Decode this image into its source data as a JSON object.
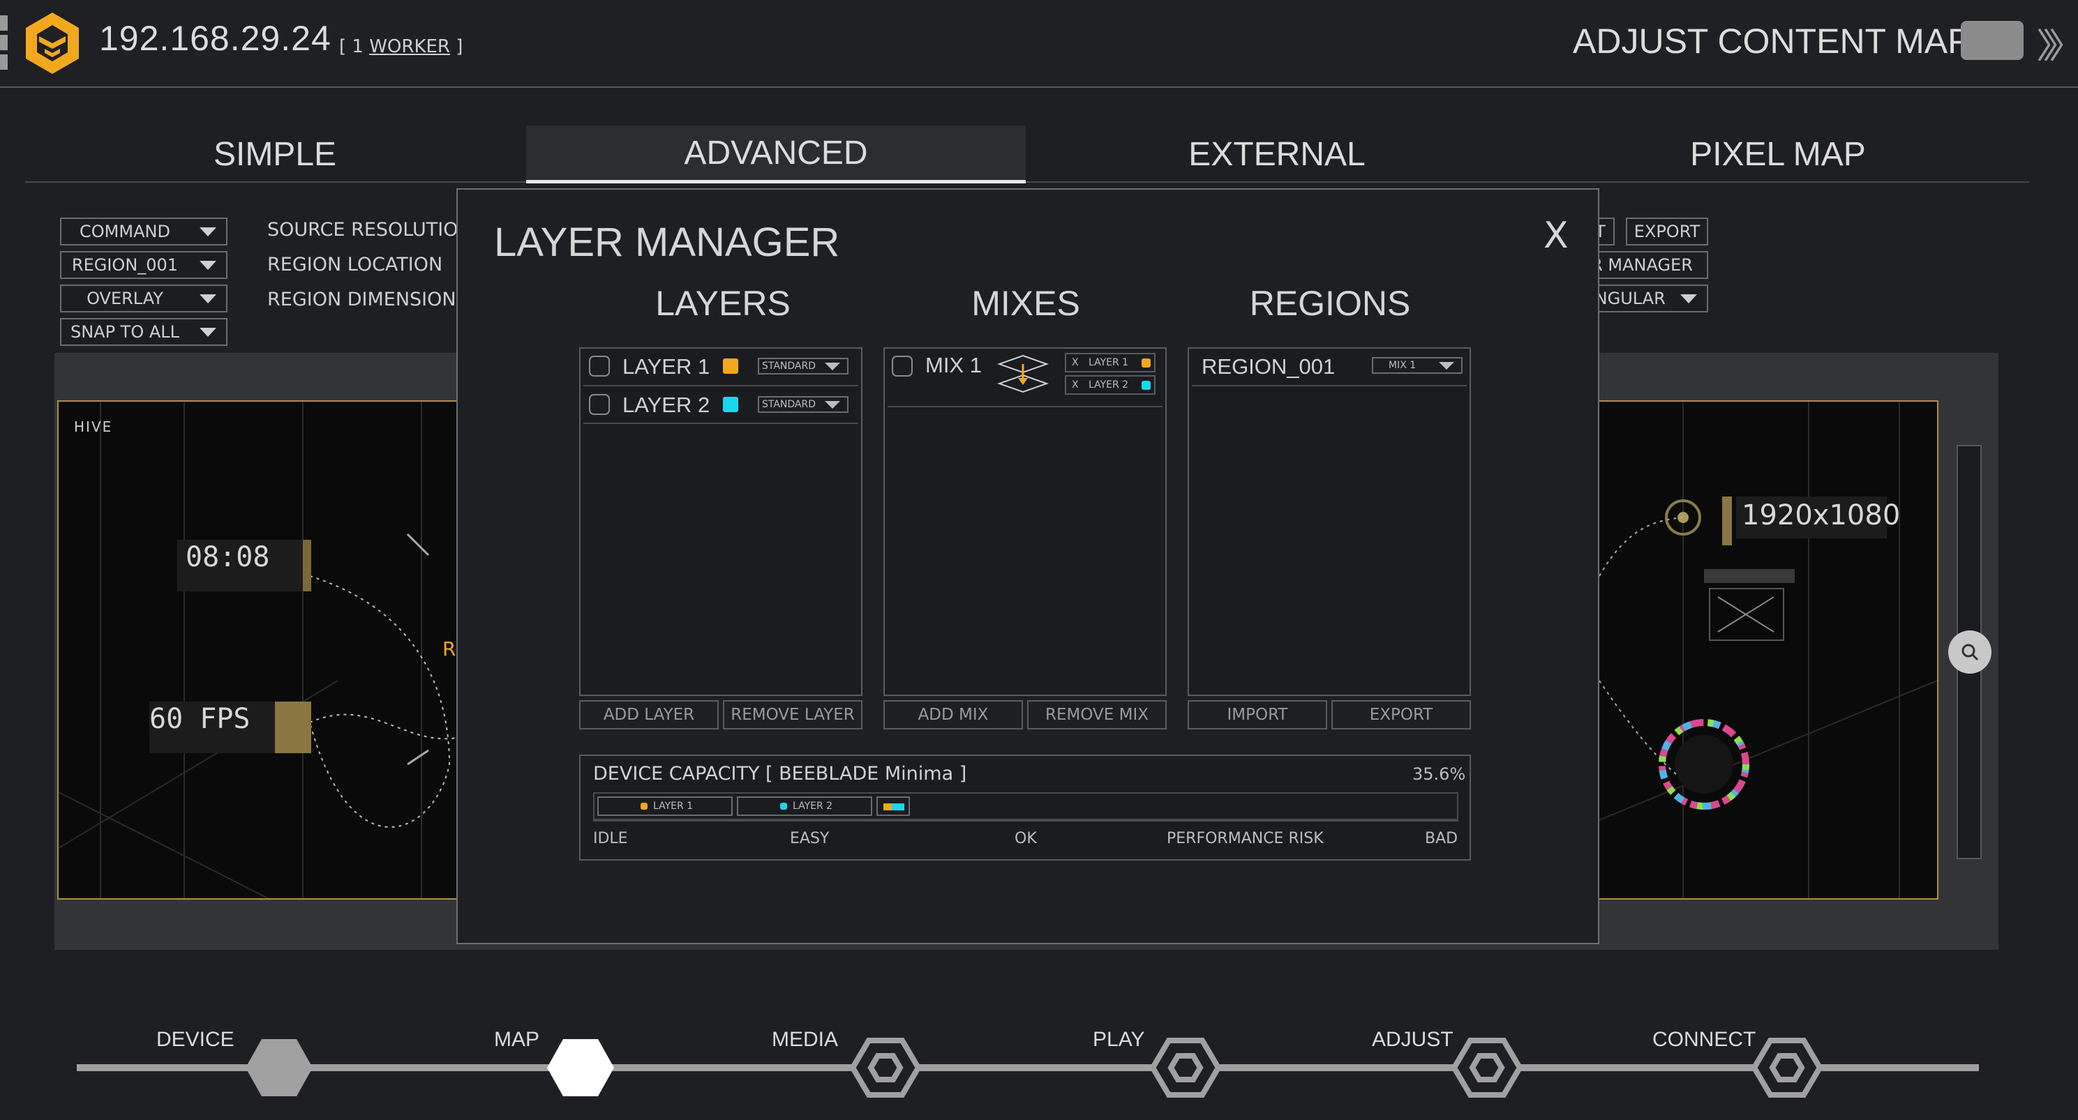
{
  "header": {
    "ip": "192.168.29.24",
    "worker_prefix": "[ 1 ",
    "worker_link": "WORKER",
    "worker_suffix": " ]",
    "title": "ADJUST CONTENT MAP"
  },
  "tabs": [
    {
      "label": "SIMPLE",
      "active": false
    },
    {
      "label": "ADVANCED",
      "active": true
    },
    {
      "label": "EXTERNAL",
      "active": false
    },
    {
      "label": "PIXEL MAP",
      "active": false
    }
  ],
  "left_controls": {
    "dropdowns": [
      "COMMAND",
      "REGION_001",
      "OVERLAY",
      "SNAP TO ALL"
    ],
    "labels": [
      "SOURCE RESOLUTION",
      "REGION LOCATION",
      "REGION DIMENSIONS"
    ]
  },
  "right_controls": {
    "buttons_row1": [
      "RT",
      "EXPORT"
    ],
    "button_row2": "R MANAGER",
    "dropdown_row3": "ANGULAR"
  },
  "preview": {
    "left_tag": "HIVE",
    "clock": "08:08",
    "fps": "60 FPS",
    "letter_r": "R",
    "resolution": "1920x1080"
  },
  "modal": {
    "title": "LAYER MANAGER",
    "close": "X",
    "columns": {
      "layers": "LAYERS",
      "mixes": "MIXES",
      "regions": "REGIONS"
    },
    "layers": [
      {
        "name": "LAYER 1",
        "color": "#f2a81d",
        "blend": "STANDARD"
      },
      {
        "name": "LAYER 2",
        "color": "#19d8ec",
        "blend": "STANDARD"
      }
    ],
    "mixes": [
      {
        "name": "MIX 1",
        "members": [
          {
            "x": "X",
            "name": "LAYER 1",
            "color": "#f2a81d"
          },
          {
            "x": "X",
            "name": "LAYER 2",
            "color": "#19d8ec"
          }
        ]
      }
    ],
    "regions": [
      {
        "name": "REGION_001",
        "mix": "MIX 1"
      }
    ],
    "buttons": {
      "add_layer": "ADD LAYER",
      "remove_layer": "REMOVE LAYER",
      "add_mix": "ADD MIX",
      "remove_mix": "REMOVE MIX",
      "import": "IMPORT",
      "export": "EXPORT"
    },
    "capacity": {
      "label": "DEVICE CAPACITY [ BEEBLADE Minima ]",
      "percent": "35.6%",
      "chips": [
        {
          "name": "LAYER 1",
          "color": "#f2a81d"
        },
        {
          "name": "LAYER 2",
          "color": "#19d8ec"
        }
      ],
      "scale": [
        "IDLE",
        "EASY",
        "OK",
        "PERFORMANCE RISK",
        "BAD"
      ]
    }
  },
  "timeline": [
    {
      "label": "DEVICE",
      "state": "done"
    },
    {
      "label": "MAP",
      "state": "current"
    },
    {
      "label": "MEDIA",
      "state": "todo"
    },
    {
      "label": "PLAY",
      "state": "todo"
    },
    {
      "label": "ADJUST",
      "state": "todo"
    },
    {
      "label": "CONNECT",
      "state": "todo"
    }
  ],
  "colors": {
    "accent_gold": "#f2a81d",
    "accent_cyan": "#19d8ec",
    "background": "#1e1f22"
  }
}
